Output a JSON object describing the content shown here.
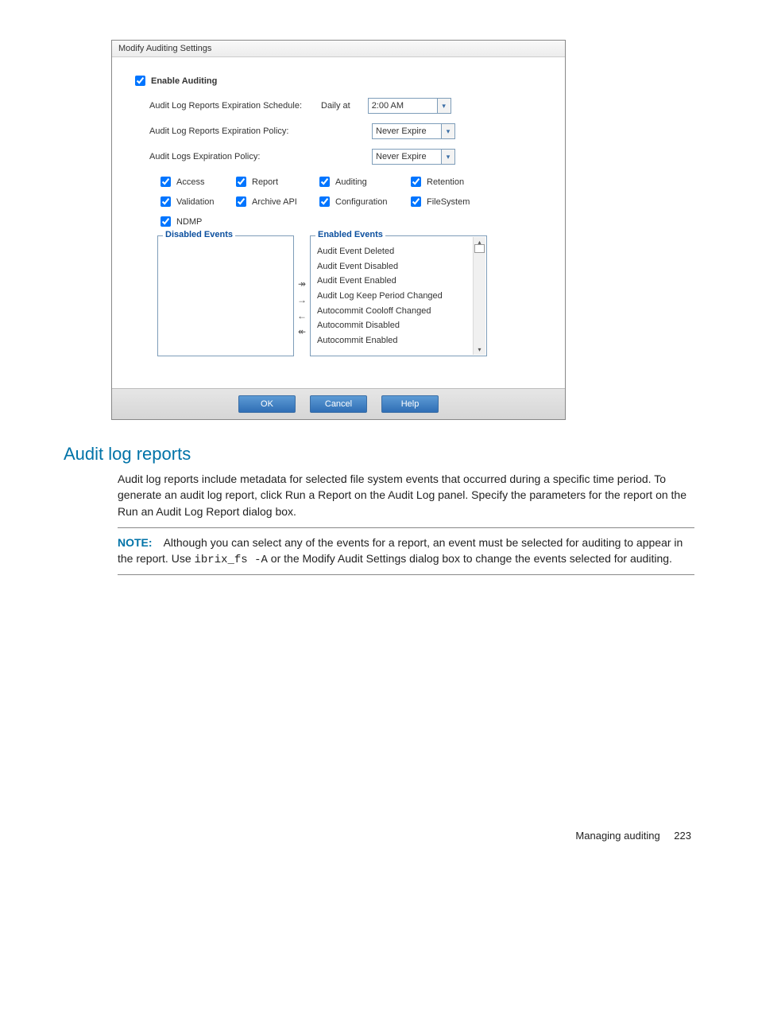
{
  "dialog": {
    "title": "Modify Auditing Settings",
    "enable_label": "Enable Auditing",
    "schedule": {
      "label": "Audit Log Reports Expiration Schedule:",
      "daily": "Daily at",
      "time": "2:00 AM"
    },
    "reports_policy": {
      "label": "Audit Log Reports Expiration Policy:",
      "value": "Never Expire"
    },
    "logs_policy": {
      "label": "Audit Logs Expiration Policy:",
      "value": "Never Expire"
    },
    "categories": [
      "Access",
      "Report",
      "Auditing",
      "Retention",
      "Validation",
      "Archive API",
      "Configuration",
      "FileSystem",
      "NDMP"
    ],
    "disabled_legend": "Disabled Events",
    "enabled_legend": "Enabled Events",
    "enabled_events": [
      "Audit Event Deleted",
      "Audit Event Disabled",
      "Audit Event Enabled",
      "Audit Log Keep Period Changed",
      "Autocommit Cooloff Changed",
      "Autocommit Disabled",
      "Autocommit Enabled"
    ],
    "buttons": {
      "ok": "OK",
      "cancel": "Cancel",
      "help": "Help"
    }
  },
  "section": {
    "heading": "Audit log reports",
    "para": "Audit log reports include metadata for selected file system events that occurred during a specific time period. To generate an audit log report, click Run a Report on the Audit Log panel. Specify the parameters for the report on the Run an Audit Log Report dialog box.",
    "note_label": "NOTE:",
    "note_a": "Although you can select any of the events for a report, an event must be selected for auditing to appear in the report. Use ",
    "note_code": "ibrix_fs -A",
    "note_b": " or the Modify Audit Settings dialog box to change the events selected for auditing."
  },
  "footer": {
    "text": "Managing auditing",
    "page": "223"
  }
}
